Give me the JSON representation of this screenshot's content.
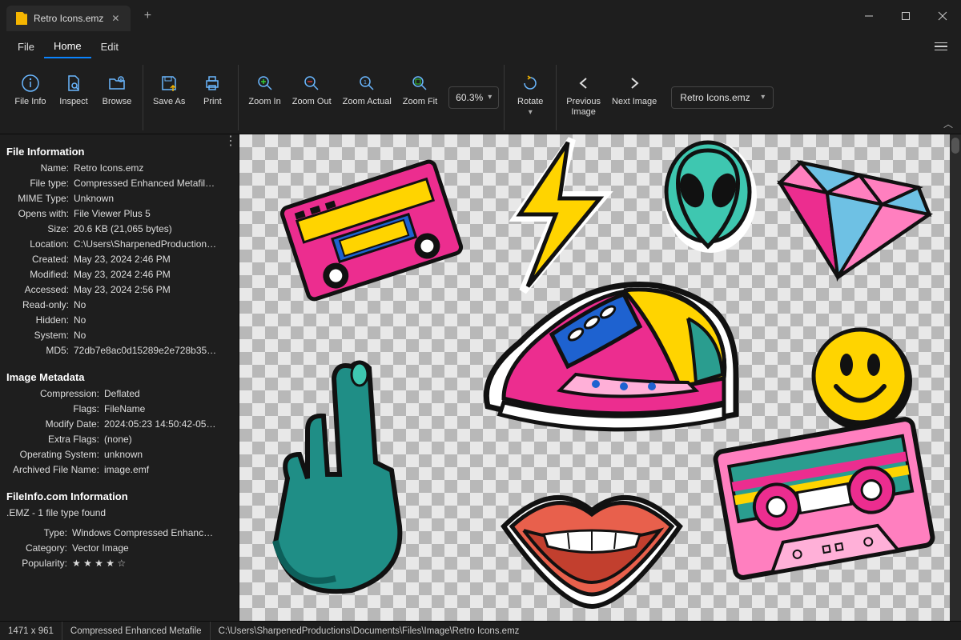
{
  "tab": {
    "title": "Retro Icons.emz"
  },
  "menu": {
    "file": "File",
    "home": "Home",
    "edit": "Edit"
  },
  "ribbon": {
    "file_info": "File Info",
    "inspect": "Inspect",
    "browse": "Browse",
    "save_as": "Save As",
    "print": "Print",
    "zoom_in": "Zoom In",
    "zoom_out": "Zoom Out",
    "zoom_actual": "Zoom Actual",
    "zoom_fit": "Zoom Fit",
    "zoom_value": "60.3%",
    "rotate": "Rotate",
    "prev_image": "Previous\nImage",
    "next_image": "Next Image",
    "file_combo": "Retro Icons.emz"
  },
  "file_info_section": "File Information",
  "file_info": {
    "Name": "Retro Icons.emz",
    "File type": "Compressed Enhanced Metafile (.e...",
    "MIME Type": "Unknown",
    "Opens with": "File Viewer Plus 5",
    "Size": "20.6 KB (21,065 bytes)",
    "Location": "C:\\Users\\SharpenedProductions\\D...",
    "Created": "May 23, 2024 2:46 PM",
    "Modified": "May 23, 2024 2:46 PM",
    "Accessed": "May 23, 2024 2:56 PM",
    "Read-only": "No",
    "Hidden": "No",
    "System": "No",
    "MD5": "72db7e8ac0d15289e2e728b3593682..."
  },
  "metadata_section": "Image Metadata",
  "metadata": {
    "Compression": "Deflated",
    "Flags": "FileName",
    "Modify Date": "2024:05:23 14:50:42-05:00",
    "Extra Flags": "(none)",
    "Operating System": "unknown",
    "Archived File Name": "image.emf"
  },
  "fileinfo_section": "FileInfo.com Information",
  "fileinfo_note": ".EMZ - 1 file type found",
  "fileinfo": {
    "Type": "Windows Compressed Enhanced ...",
    "Category": "Vector Image",
    "Popularity": "★ ★ ★ ★ ☆"
  },
  "status": {
    "dims": "1471 x 961",
    "type": "Compressed Enhanced Metafile",
    "path": "C:\\Users\\SharpenedProductions\\Documents\\Files\\Image\\Retro Icons.emz"
  }
}
